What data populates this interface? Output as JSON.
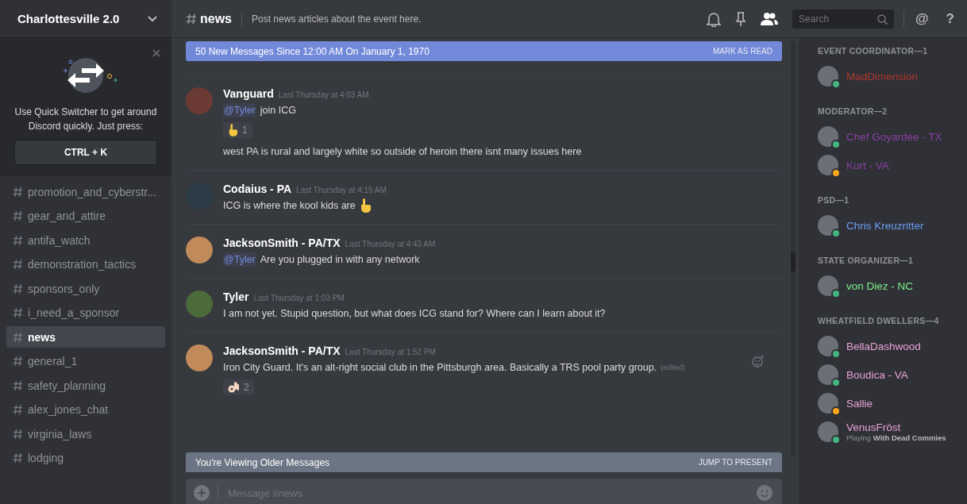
{
  "server": {
    "name": "Charlottesville 2.0"
  },
  "tip": {
    "text": "Use Quick Switcher to get around Discord quickly. Just press:",
    "shortcut": "CTRL + K"
  },
  "channels": [
    {
      "name": "promotion_and_cyberstr...",
      "selected": false
    },
    {
      "name": "gear_and_attire",
      "selected": false
    },
    {
      "name": "antifa_watch",
      "selected": false
    },
    {
      "name": "demonstration_tactics",
      "selected": false
    },
    {
      "name": "sponsors_only",
      "selected": false
    },
    {
      "name": "i_need_a_sponsor",
      "selected": false
    },
    {
      "name": "news",
      "selected": true
    },
    {
      "name": "general_1",
      "selected": false
    },
    {
      "name": "safety_planning",
      "selected": false
    },
    {
      "name": "alex_jones_chat",
      "selected": false
    },
    {
      "name": "virginia_laws",
      "selected": false
    },
    {
      "name": "lodging",
      "selected": false
    }
  ],
  "header": {
    "channel": "news",
    "topic": "Post news articles about the event here.",
    "search_placeholder": "Search",
    "buttons": [
      "@",
      "?"
    ]
  },
  "new_messages_bar": {
    "text": "50 New Messages Since 12:00 AM On January 1, 1970",
    "action": "MARK AS READ"
  },
  "messages": [
    {
      "author": "Vanguard",
      "timestamp": "Last Thursday at 4:03 AM",
      "lines": [
        {
          "mention": "@Tyler",
          "text": "join ICG"
        }
      ],
      "reactions": [
        {
          "kind": "point",
          "count": "1"
        }
      ],
      "more_lines": [
        {
          "text": "west PA is rural and largely white so outside of heroin there isnt many issues here"
        }
      ]
    },
    {
      "author": "Codaius - PA",
      "timestamp": "Last Thursday at 4:15 AM",
      "lines": [
        {
          "text": "ICG is where the kool kids are",
          "emoji": {
            "kind": "point"
          }
        }
      ]
    },
    {
      "author": "JacksonSmith - PA/TX",
      "timestamp": "Last Thursday at 4:43 AM",
      "lines": [
        {
          "mention": "@Tyler",
          "text": "Are you plugged in with any network"
        }
      ]
    },
    {
      "author": "Tyler",
      "timestamp": "Last Thursday at 1:03 PM",
      "lines": [
        {
          "text": "I am not yet. Stupid question, but what does ICG stand for? Where can I learn about it?"
        }
      ]
    },
    {
      "author": "JacksonSmith - PA/TX",
      "timestamp": "Last Thursday at 1:52 PM",
      "lines": [
        {
          "text": "Iron City Guard. It's an alt-right social club in the Pittsburgh area. Basically a TRS pool party group.",
          "edited": "(edited)"
        }
      ],
      "reactions": [
        {
          "kind": "ok",
          "count": "2"
        }
      ]
    }
  ],
  "older_messages_bar": {
    "text": "You're Viewing Older Messages",
    "action": "JUMP TO PRESENT"
  },
  "composer": {
    "placeholder": "Message #news"
  },
  "member_groups": [
    {
      "title": "EVENT COORDINATOR—1",
      "members": [
        {
          "name": "MadDimension",
          "color": "#b0372d",
          "idle": false
        }
      ]
    },
    {
      "title": "MODERATOR—2",
      "members": [
        {
          "name": "Chef Goyardee - TX",
          "color": "#8b3fa3",
          "idle": false
        },
        {
          "name": "Kurt - VA",
          "color": "#8b3fa3",
          "idle": true
        }
      ]
    },
    {
      "title": "PSD—1",
      "members": [
        {
          "name": "Chris Kreuzritter",
          "color": "#6e9cf2",
          "idle": false
        }
      ]
    },
    {
      "title": "STATE ORGANIZER—1",
      "members": [
        {
          "name": "von Diez - NC",
          "color": "#7cf08c",
          "idle": false
        }
      ]
    },
    {
      "title": "WHEATFIELD DWELLERS—4",
      "members": [
        {
          "name": "BellaDashwood",
          "color": "#eaa2d6",
          "idle": false
        },
        {
          "name": "Boudica - VA",
          "color": "#eaa2d6",
          "idle": false
        },
        {
          "name": "Sallie",
          "color": "#eaa2d6",
          "idle": true
        },
        {
          "name": "VenusFröst",
          "color": "#eaa2d6",
          "idle": false,
          "activity_prefix": "Playing",
          "activity": "With Dead Commies"
        }
      ]
    }
  ]
}
